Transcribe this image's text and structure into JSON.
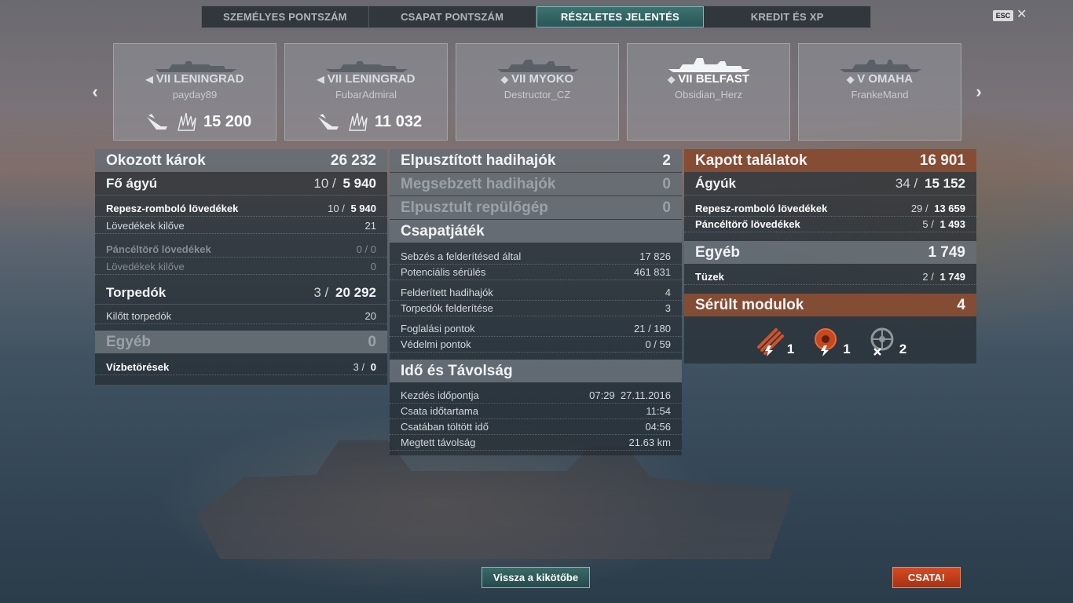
{
  "tabs": [
    {
      "label": "SZEMÉLYES PONTSZÁM",
      "active": false
    },
    {
      "label": "CSAPAT PONTSZÁM",
      "active": false
    },
    {
      "label": "RÉSZLETES JELENTÉS",
      "active": true
    },
    {
      "label": "KREDIT ÉS XP",
      "active": false
    }
  ],
  "esc": {
    "badge": "ESC",
    "close_glyph": "✕"
  },
  "nav": {
    "prev_glyph": "‹",
    "next_glyph": "›"
  },
  "cards": [
    {
      "tier": "VII",
      "ship": "LENINGRAD",
      "class_icon": "destroyer-icon",
      "player": "payday89",
      "score": "15 200",
      "highlight": false
    },
    {
      "tier": "VII",
      "ship": "LENINGRAD",
      "class_icon": "destroyer-icon",
      "player": "FubarAdmiral",
      "score": "11 032",
      "highlight": false
    },
    {
      "tier": "VII",
      "ship": "MYOKO",
      "class_icon": "cruiser-icon",
      "player": "Destructor_CZ",
      "score": "",
      "highlight": false
    },
    {
      "tier": "VII",
      "ship": "BELFAST",
      "class_icon": "cruiser-icon",
      "player": "Obsidian_Herz",
      "score": "",
      "highlight": true
    },
    {
      "tier": "V",
      "ship": "OMAHA",
      "class_icon": "cruiser-icon",
      "player": "FrankeMand",
      "score": "",
      "highlight": false
    }
  ],
  "left": {
    "header": {
      "label": "Okozott károk",
      "value": "26 232"
    },
    "main_guns": {
      "label": "Fő ágyú",
      "a": "10 /",
      "b": "5 940"
    },
    "he": {
      "label": "Repesz-romboló lövedékek",
      "a": "10 /",
      "b": "5 940"
    },
    "he_fired": {
      "label": "Lövedékek kilőve",
      "value": "21"
    },
    "ap": {
      "label": "Páncéltörő lövedékek",
      "value": "0 / 0"
    },
    "ap_fired": {
      "label": "Lövedékek kilőve",
      "value": "0"
    },
    "torpedoes": {
      "label": "Torpedók",
      "a": "3 /",
      "b": "20 292"
    },
    "torp_fired": {
      "label": "Kilőtt torpedók",
      "value": "20"
    },
    "other": {
      "label": "Egyéb",
      "value": "0"
    },
    "flooding": {
      "label": "Vízbetörések",
      "a": "3 /",
      "b": "0"
    }
  },
  "middle": {
    "destroyed": {
      "label": "Elpusztított hadihajók",
      "value": "2"
    },
    "damaged": {
      "label": "Megsebzett hadihajók",
      "value": "0"
    },
    "planes": {
      "label": "Elpusztult repülőgép",
      "value": "0"
    },
    "teamplay_header": "Csapatjáték",
    "teamplay": [
      {
        "label": "Sebzés a felderítésed által",
        "value": "17 826"
      },
      {
        "label": "Potenciális sérülés",
        "value": "461 831"
      },
      {
        "label": "Felderített hadihajók",
        "value": "4"
      },
      {
        "label": "Torpedók felderítése",
        "value": "3"
      },
      {
        "label": "Foglalási pontok",
        "value": "21 / 180"
      },
      {
        "label": "Védelmi pontok",
        "value": "0 / 59"
      }
    ],
    "time_header": "Idő és Távolság",
    "time": [
      {
        "label": "Kezdés időpontja",
        "value": "07:29  27.11.2016"
      },
      {
        "label": "Csata időtartama",
        "value": "11:54"
      },
      {
        "label": "Csatában töltött idő",
        "value": "04:56"
      },
      {
        "label": "Megtett távolság",
        "value": "21.63 km"
      }
    ]
  },
  "right": {
    "header": {
      "label": "Kapott találatok",
      "value": "16 901"
    },
    "guns": {
      "label": "Ágyúk",
      "a": "34 /",
      "b": "15 152"
    },
    "he": {
      "label": "Repesz-romboló lövedékek",
      "a": "29 /",
      "b": "13 659"
    },
    "ap": {
      "label": "Páncéltörő lövedékek",
      "a": "5 /",
      "b": "1 493"
    },
    "other": {
      "label": "Egyéb",
      "value": "1 749"
    },
    "fires": {
      "label": "Tüzek",
      "a": "2 /",
      "b": "1 749"
    },
    "modules_header": {
      "label": "Sérült modulok",
      "value": "4"
    },
    "modules": [
      {
        "icon": "torpedo-tubes-damaged-icon",
        "count": "1"
      },
      {
        "icon": "engine-damaged-icon",
        "count": "1"
      },
      {
        "icon": "steering-destroyed-icon",
        "count": "2"
      }
    ]
  },
  "buttons": {
    "back": "Vissza a kikötőbe",
    "battle": "CSATA!"
  },
  "colors": {
    "accent_teal": "#3d7270",
    "battle_orange": "#d64a22",
    "header_orange": "#96502f"
  }
}
